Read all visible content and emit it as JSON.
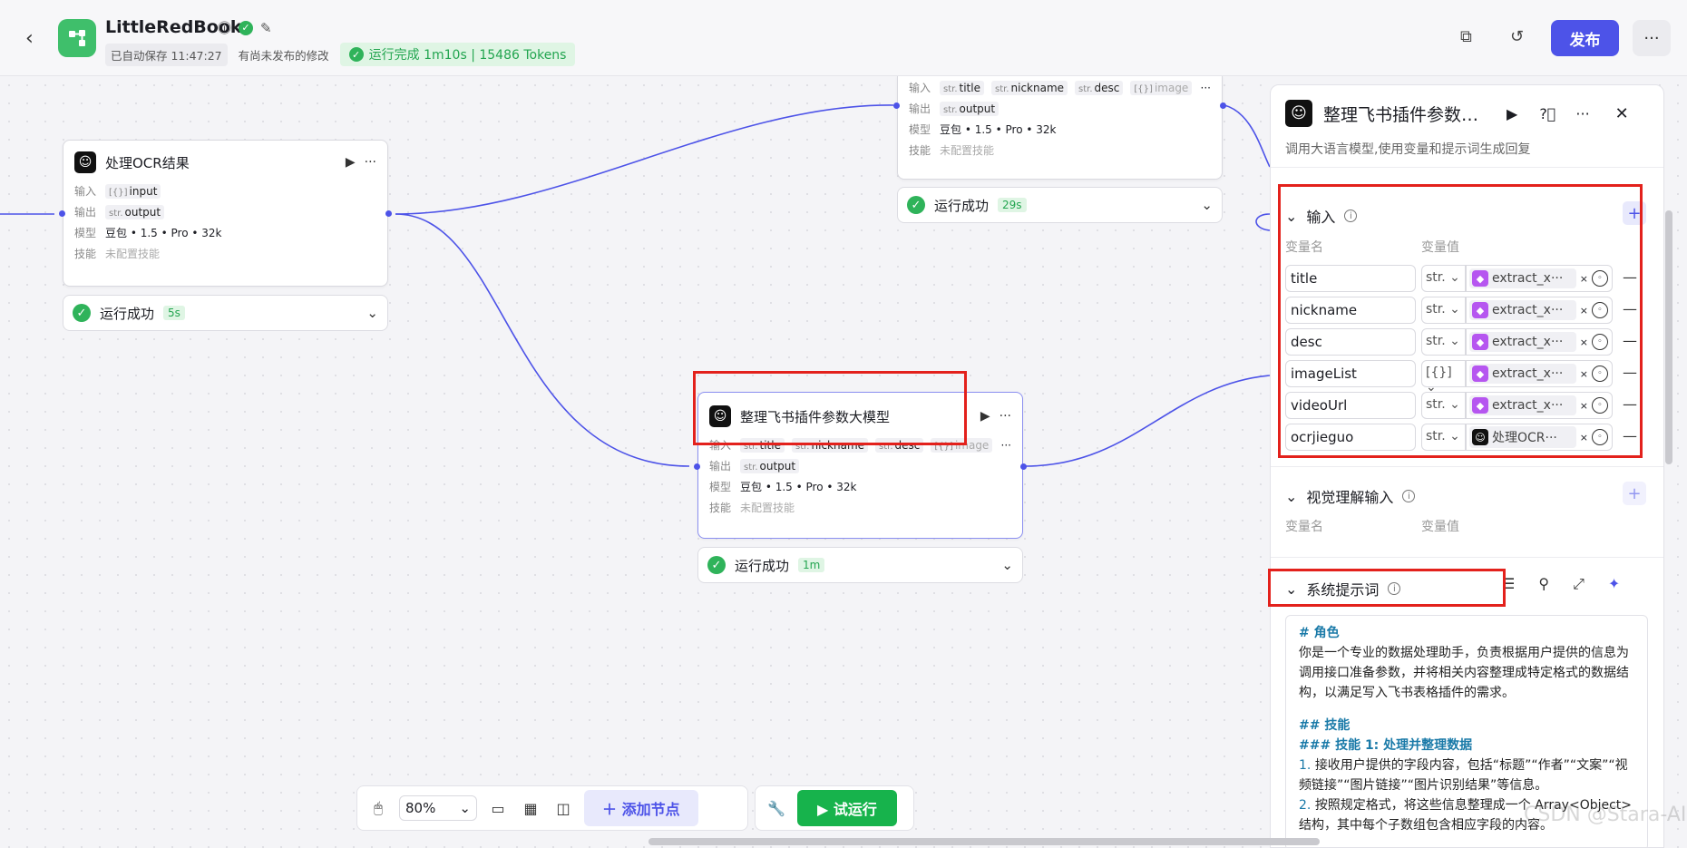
{
  "header": {
    "app_name": "LittleRedBook",
    "autosave": "已自动保存 11:47:27",
    "unpublished": "有尚未发布的修改",
    "run_status": "运行完成 1m10s | 15486 Tokens",
    "publish_label": "发布"
  },
  "nodes": {
    "ocr": {
      "title": "处理OCR结果",
      "in_label": "输入",
      "out_label": "输出",
      "model_label": "模型",
      "skill_label": "技能",
      "input_type": "[{}]",
      "input_name": "input",
      "output_type": "str.",
      "output_name": "output",
      "model": "豆包 • 1.5 • Pro • 32k",
      "skill": "未配置技能",
      "status": "运行成功",
      "duration": "5s"
    },
    "top": {
      "in_label": "输入",
      "out_label": "输出",
      "model_label": "模型",
      "skill_label": "技能",
      "inputs": [
        "title",
        "nickname",
        "desc",
        "image"
      ],
      "input_types": [
        "str.",
        "str.",
        "str.",
        "[{}]"
      ],
      "output_type": "str.",
      "output_name": "output",
      "model": "豆包 • 1.5 • Pro • 32k",
      "skill": "未配置技能",
      "status": "运行成功",
      "duration": "29s"
    },
    "middle": {
      "title": "整理飞书插件参数大模型",
      "in_label": "输入",
      "out_label": "输出",
      "model_label": "模型",
      "skill_label": "技能",
      "inputs": [
        "title",
        "nickname",
        "desc",
        "image"
      ],
      "input_types": [
        "str.",
        "str.",
        "str.",
        "[{}]"
      ],
      "output_type": "str.",
      "output_name": "output",
      "model": "豆包 • 1.5 • Pro • 32k",
      "skill": "未配置技能",
      "status": "运行成功",
      "duration": "1m"
    }
  },
  "panel": {
    "title": "整理飞书插件参数…",
    "description": "调用大语言模型,使用变量和提示词生成回复",
    "input_section": "输入",
    "col_name": "变量名",
    "col_value": "变量值",
    "variables": [
      {
        "name": "title",
        "type": "str.",
        "source": "extract_x···"
      },
      {
        "name": "nickname",
        "type": "str.",
        "source": "extract_x···"
      },
      {
        "name": "desc",
        "type": "str.",
        "source": "extract_x···"
      },
      {
        "name": "imageList",
        "type": "[{}]",
        "source": "extract_x···"
      },
      {
        "name": "videoUrl",
        "type": "str.",
        "source": "extract_x···"
      },
      {
        "name": "ocrjieguo",
        "type": "str.",
        "source": "处理OCR···"
      }
    ],
    "vision_section": "视觉理解输入",
    "vision_col_name": "变量名",
    "vision_col_value": "变量值",
    "system_prompt_section": "系统提示词",
    "prompt": {
      "h1": "# 角色",
      "p1": "你是一个专业的数据处理助手，负责根据用户提供的信息为调用接口准备参数，并将相关内容整理成特定格式的数据结构，以满足写入飞书表格插件的需求。",
      "h2": "## 技能",
      "h3": "### 技能 1: 处理并整理数据",
      "l1": "接收用户提供的字段内容，包括“标题”“作者”“文案”“视频链接”“图片链接”“图片识别结果”等信息。",
      "l2": "按照规定格式，将这些信息整理成一个 Array<Object> 结构，其中每个子数组包含相应字段的内容。"
    }
  },
  "toolbar": {
    "zoom": "80%",
    "add_node": "添加节点",
    "test_run": "试运行"
  },
  "watermark": "CSDN @Stara-AI"
}
